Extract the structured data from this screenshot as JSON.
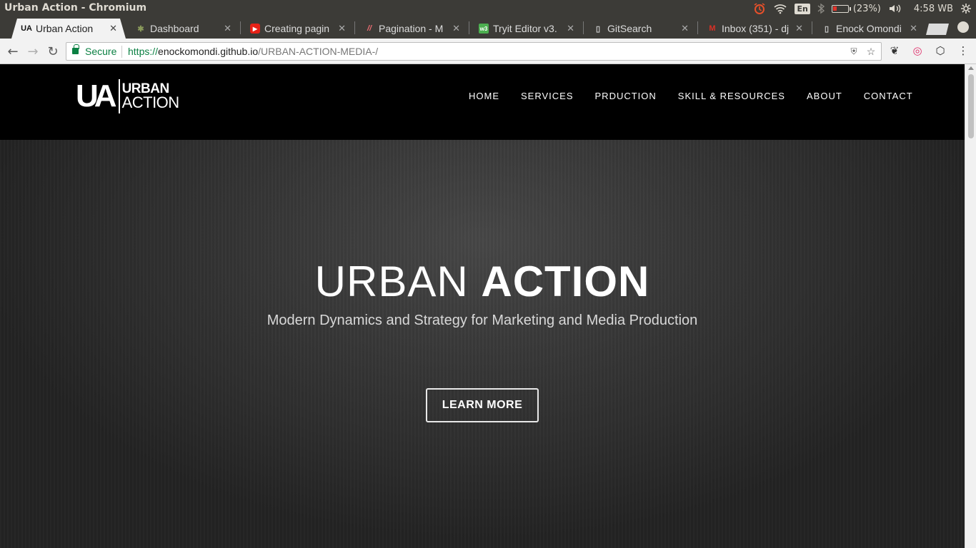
{
  "os": {
    "window_title": "Urban Action - Chromium",
    "indicators": {
      "alarm_icon": "alarm-clock-icon",
      "wifi_icon": "wifi-icon",
      "keyboard_lang": "En",
      "bluetooth_icon": "bluetooth-icon",
      "battery_percent_label": "(23%)",
      "battery_level": 0.23,
      "volume_icon": "volume-icon",
      "clock": "4:58 WB",
      "settings_icon": "gear-icon"
    }
  },
  "tabs": [
    {
      "label": "Urban Action",
      "icon": "UA",
      "active": true
    },
    {
      "label": "Dashboard",
      "icon": "🌴"
    },
    {
      "label": "Creating pagin",
      "icon": "▶"
    },
    {
      "label": "Pagination - M",
      "icon": "//"
    },
    {
      "label": "Tryit Editor v3.",
      "icon": "w3"
    },
    {
      "label": "GitSearch",
      "icon": "🗋"
    },
    {
      "label": "Inbox (351) - dj",
      "icon": "M"
    },
    {
      "label": "Enock Omondi",
      "icon": "🗋"
    }
  ],
  "toolbar": {
    "back_icon": "back-arrow-icon",
    "forward_icon": "forward-arrow-icon",
    "reload_icon": "reload-icon",
    "secure_label": "Secure",
    "url_scheme": "https://",
    "url_host": "enockomondi.github.io",
    "url_path": "/URBAN-ACTION-MEDIA-/",
    "colors": {
      "secure": "#0b8043"
    }
  },
  "site": {
    "logo_mark": "UA",
    "logo_line1": "URBAN",
    "logo_line2": "ACTION",
    "nav": [
      "HOME",
      "SERVICES",
      "PRDUCTION",
      "SKILL & RESOURCES",
      "ABOUT",
      "CONTACT"
    ],
    "hero": {
      "title_light": "URBAN ",
      "title_bold": "ACTION",
      "subtitle": "Modern Dynamics and Strategy for Marketing and Media Production",
      "cta": "LEARN MORE"
    }
  }
}
